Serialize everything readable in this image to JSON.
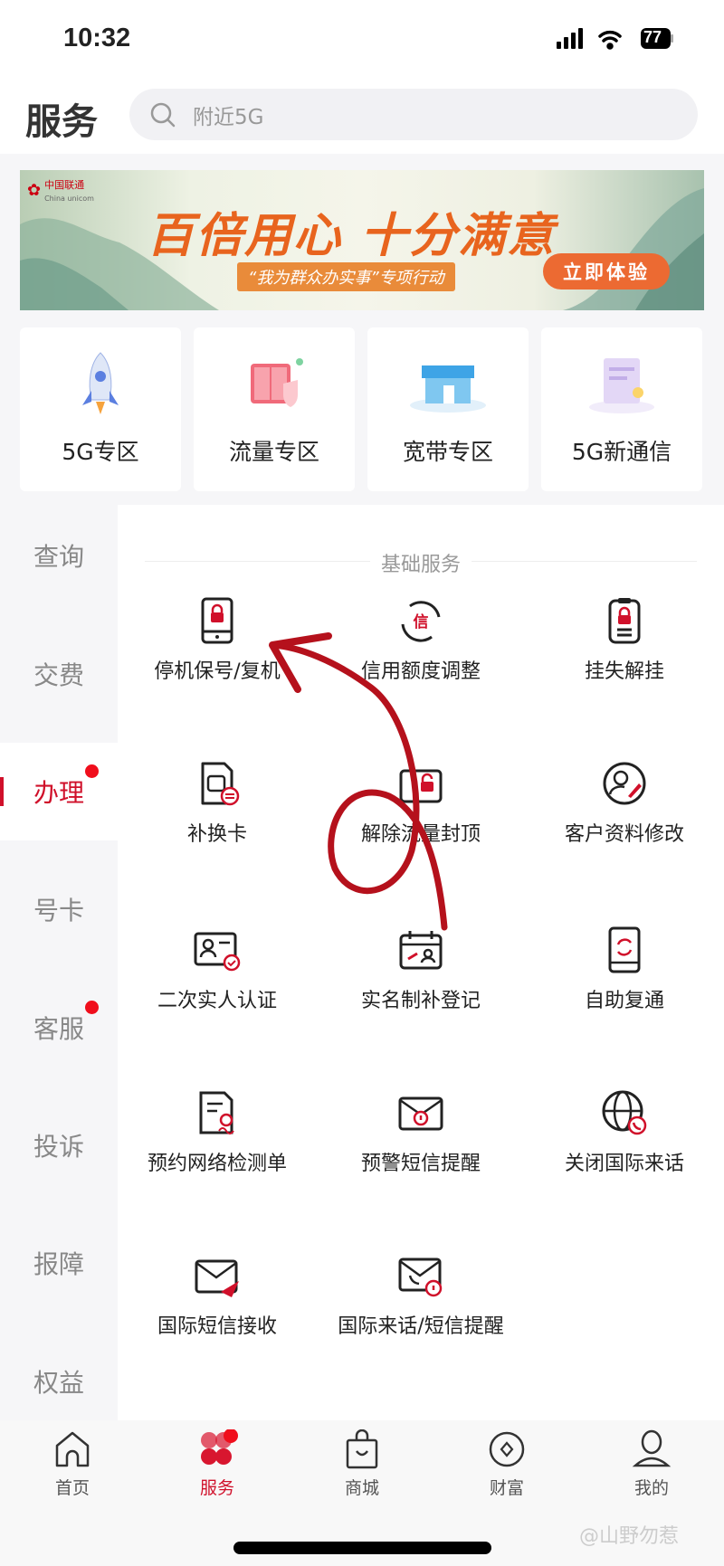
{
  "status_bar": {
    "time": "10:32",
    "battery": "77"
  },
  "header": {
    "title": "服务",
    "search_placeholder": "附近5G"
  },
  "banner": {
    "logo_cn": "中国联通",
    "logo_en": "China unicom",
    "title": "百倍用心 十分满意",
    "subtitle": "“我为群众办实事”专项行动",
    "button": "立即体验"
  },
  "tiles": [
    {
      "label": "5G专区",
      "icon": "rocket-icon"
    },
    {
      "label": "流量专区",
      "icon": "data-box-icon"
    },
    {
      "label": "宽带专区",
      "icon": "store-icon"
    },
    {
      "label": "5G新通信",
      "icon": "message-doc-icon"
    }
  ],
  "sidebar": {
    "items": [
      {
        "label": "查询"
      },
      {
        "label": "交费"
      },
      {
        "label": "办理",
        "active": true,
        "badge": true
      },
      {
        "label": "号卡"
      },
      {
        "label": "客服",
        "badge": true
      },
      {
        "label": "投诉"
      },
      {
        "label": "报障"
      },
      {
        "label": "权益"
      }
    ]
  },
  "section": {
    "title": "基础服务",
    "items": [
      {
        "label": "停机保号/复机",
        "icon": "phone-lock-icon"
      },
      {
        "label": "信用额度调整",
        "icon": "credit-refresh-icon"
      },
      {
        "label": "挂失解挂",
        "icon": "clipboard-lock-icon"
      },
      {
        "label": "补换卡",
        "icon": "sim-swap-icon"
      },
      {
        "label": "解除流量封顶",
        "icon": "unlock-data-icon"
      },
      {
        "label": "客户资料修改",
        "icon": "user-edit-icon"
      },
      {
        "label": "二次实人认证",
        "icon": "id-verify-icon"
      },
      {
        "label": "实名制补登记",
        "icon": "id-register-icon"
      },
      {
        "label": "自助复通",
        "icon": "phone-refresh-icon"
      },
      {
        "label": "预约网络检测单",
        "icon": "doc-check-icon"
      },
      {
        "label": "预警短信提醒",
        "icon": "mail-alert-icon"
      },
      {
        "label": "关闭国际来话",
        "icon": "globe-phone-icon"
      },
      {
        "label": "国际短信接收",
        "icon": "mail-send-icon"
      },
      {
        "label": "国际来话/短信提醒",
        "icon": "mail-phone-icon"
      }
    ]
  },
  "nav": {
    "items": [
      {
        "label": "首页",
        "icon": "home-icon"
      },
      {
        "label": "服务",
        "icon": "clover-icon",
        "active": true,
        "badge": true
      },
      {
        "label": "商城",
        "icon": "shopping-bag-icon"
      },
      {
        "label": "财富",
        "icon": "coin-icon"
      },
      {
        "label": "我的",
        "icon": "user-icon"
      }
    ]
  },
  "watermark": "@山野勿惹",
  "colors": {
    "accent": "#d0102a",
    "badge": "#f00e1c",
    "annotation": "#b5111c"
  }
}
